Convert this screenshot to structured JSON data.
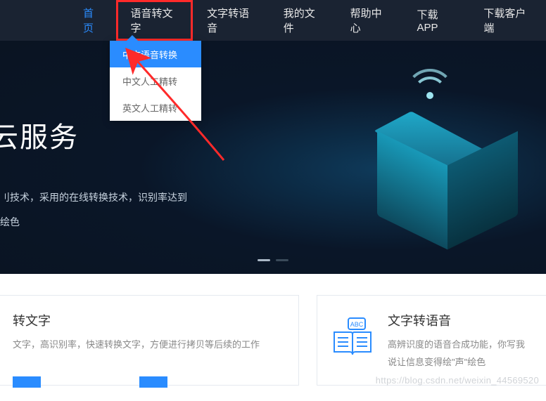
{
  "nav": {
    "items": [
      {
        "label": "首页",
        "active": true
      },
      {
        "label": "语音转文字",
        "highlighted": true
      },
      {
        "label": "文字转语音"
      },
      {
        "label": "我的文件"
      },
      {
        "label": "帮助中心"
      },
      {
        "label": "下载APP"
      },
      {
        "label": "下载客户端"
      }
    ]
  },
  "dropdown": {
    "items": [
      {
        "label": "中文语音转换",
        "selected": true
      },
      {
        "label": "中文人工精转"
      },
      {
        "label": "英文人工精转"
      }
    ]
  },
  "hero": {
    "title": "云服务",
    "line1": "刂技术，采用的在线转换技术，识别率达到",
    "line2": "绘色"
  },
  "features": {
    "card1": {
      "title": "转文字",
      "desc": "文字，高识别率，快速转换文字，方便进行拷贝等后续的工作",
      "icon": "speech-to-text-icon"
    },
    "card2": {
      "title": "文字转语音",
      "desc": "高辨识度的语音合成功能，你写我说让信息变得绘\"声\"绘色",
      "icon": "text-to-speech-icon"
    }
  },
  "watermark": "https://blog.csdn.net/weixin_44569520",
  "colors": {
    "accent": "#2a8cff",
    "annotation": "#ff2a2a",
    "nav_bg": "#1a2332"
  }
}
